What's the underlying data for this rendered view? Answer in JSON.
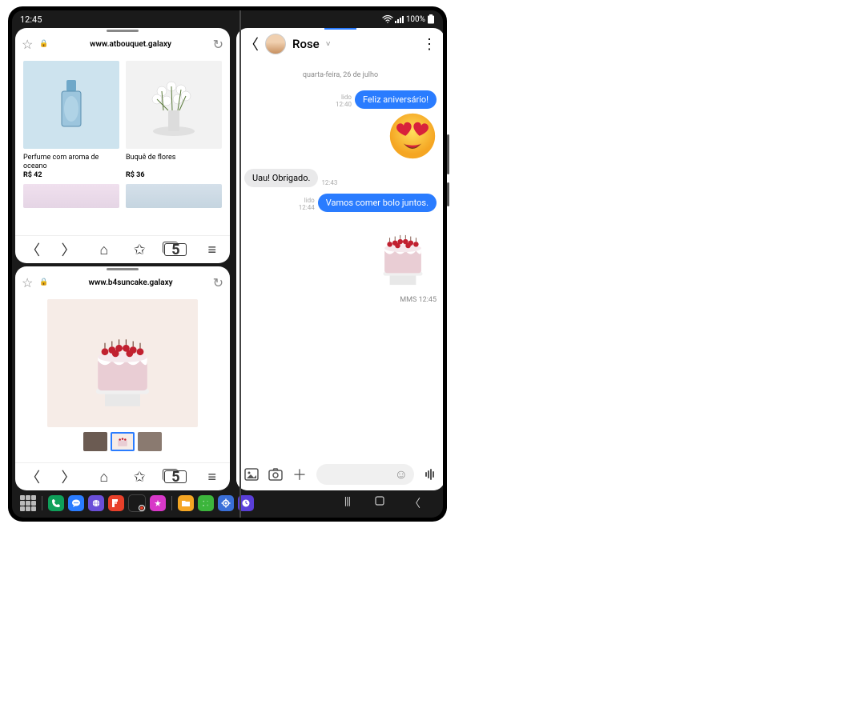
{
  "status": {
    "time": "12:45",
    "battery": "100%"
  },
  "browser1": {
    "url": "www.atbouquet.galaxy",
    "tab_count": "5",
    "products": [
      {
        "name": "Perfume com aroma de oceano",
        "price": "R$ 42"
      },
      {
        "name": "Buquê de flores",
        "price": "R$ 36"
      }
    ]
  },
  "browser2": {
    "url": "www.b4suncake.galaxy",
    "tab_count": "5"
  },
  "chat": {
    "contact": "Rose",
    "date": "quarta-feira, 26 de julho",
    "msg1": {
      "text": "Feliz aniversário!",
      "status": "lido",
      "time": "12:40"
    },
    "msg2": {
      "text": "Uau! Obrigado.",
      "time": "12:43"
    },
    "msg3": {
      "text": "Vamos comer bolo juntos.",
      "status": "lido",
      "time": "12:44"
    },
    "mms": {
      "label": "MMS 12:45"
    }
  },
  "icons": {
    "star": "☆",
    "lock": "🔒",
    "reload": "↻",
    "back": "〈",
    "fwd": "〉",
    "home": "⌂",
    "fav": "✩",
    "menu": "≡",
    "back_arrow": "〈",
    "chev": "˅",
    "dots": "⋮",
    "gallery": "🖼",
    "camera": "◉",
    "plus": "＋",
    "smile": "☺",
    "voice": "⦀",
    "recents": "|||",
    "nav_home": "▢",
    "nav_back": "〈"
  }
}
